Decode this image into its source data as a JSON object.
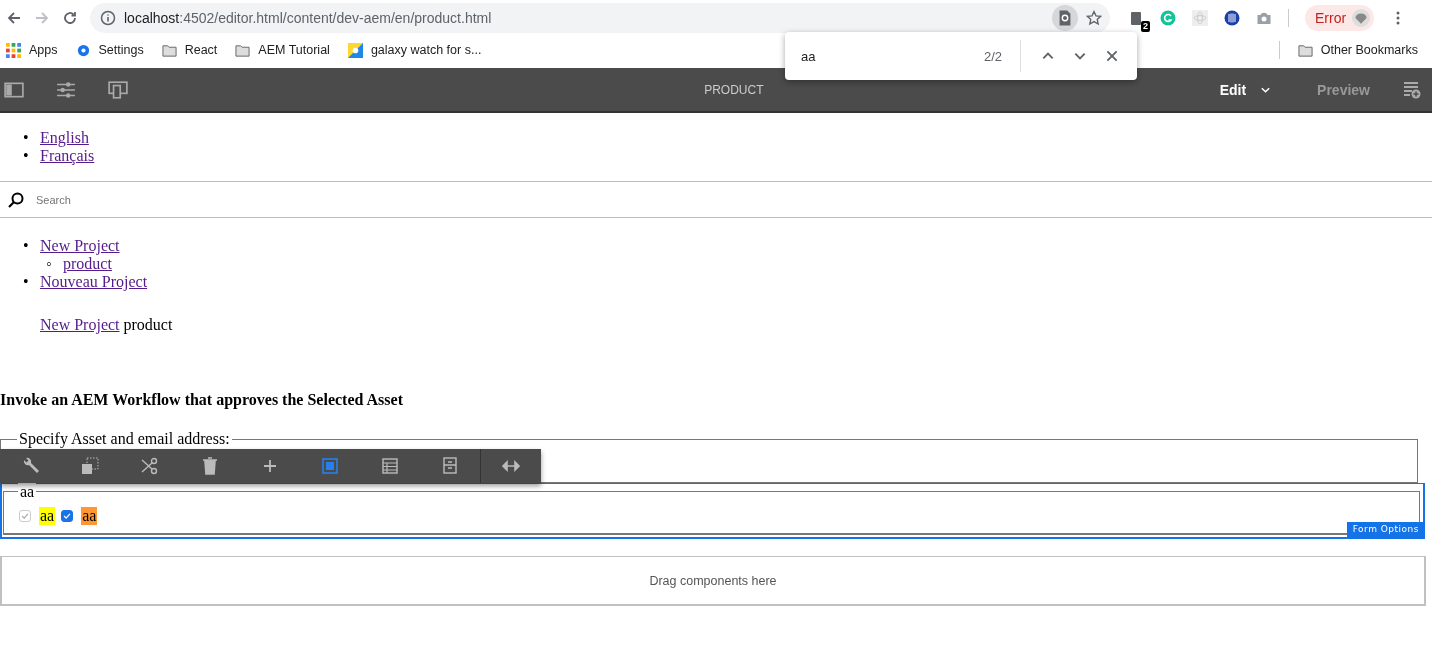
{
  "browser": {
    "url_host": "localhost",
    "url_path": ":4502/editor.html/content/dev-aem/en/product.html",
    "extension_badge": "2",
    "profile_status": "Error",
    "bookmarks": [
      {
        "kind": "apps",
        "label": "Apps"
      },
      {
        "kind": "gear",
        "label": "Settings"
      },
      {
        "kind": "folder",
        "label": "React"
      },
      {
        "kind": "folder",
        "label": "AEM Tutorial"
      },
      {
        "kind": "site",
        "label": "galaxy watch for s..."
      }
    ],
    "other_bookmarks": "Other Bookmarks"
  },
  "find_bar": {
    "query": "aa",
    "count": "2/2"
  },
  "editor_toolbar": {
    "title": "PRODUCT",
    "mode": "Edit",
    "preview": "Preview"
  },
  "language_links": [
    {
      "marker": "•",
      "label": "English"
    },
    {
      "marker": "•",
      "label": "Français"
    }
  ],
  "search": {
    "placeholder": "Search"
  },
  "nav": [
    {
      "marker": "•",
      "label": "New Project",
      "children": [
        {
          "marker": "◦",
          "label": "product"
        }
      ]
    },
    {
      "marker": "•",
      "label": "Nouveau Project"
    }
  ],
  "breadcrumb": {
    "link": "New Project",
    "current": "product"
  },
  "heading": "Invoke an AEM Workflow that approves the Selected Asset",
  "fieldset_legend": "Specify Asset and email address:",
  "component_toolbar": [
    {
      "kind": "wrench",
      "selected": false
    },
    {
      "kind": "copy",
      "selected": false
    },
    {
      "kind": "cut",
      "selected": false
    },
    {
      "kind": "delete",
      "selected": false
    },
    {
      "kind": "insert",
      "selected": false
    },
    {
      "kind": "parent",
      "selected": true
    },
    {
      "kind": "layout",
      "selected": false
    },
    {
      "kind": "group",
      "selected": false
    },
    {
      "kind": "resize",
      "selected": false
    }
  ],
  "checkbox_group": {
    "legend": "aa",
    "options": [
      {
        "label": "aa",
        "checked": true,
        "disabled": true,
        "color": "#ffff00"
      },
      {
        "label": "aa",
        "checked": true,
        "disabled": false,
        "color": "#ff9632"
      }
    ]
  },
  "form_options": "Form Options",
  "drop_zone": "Drag components here"
}
